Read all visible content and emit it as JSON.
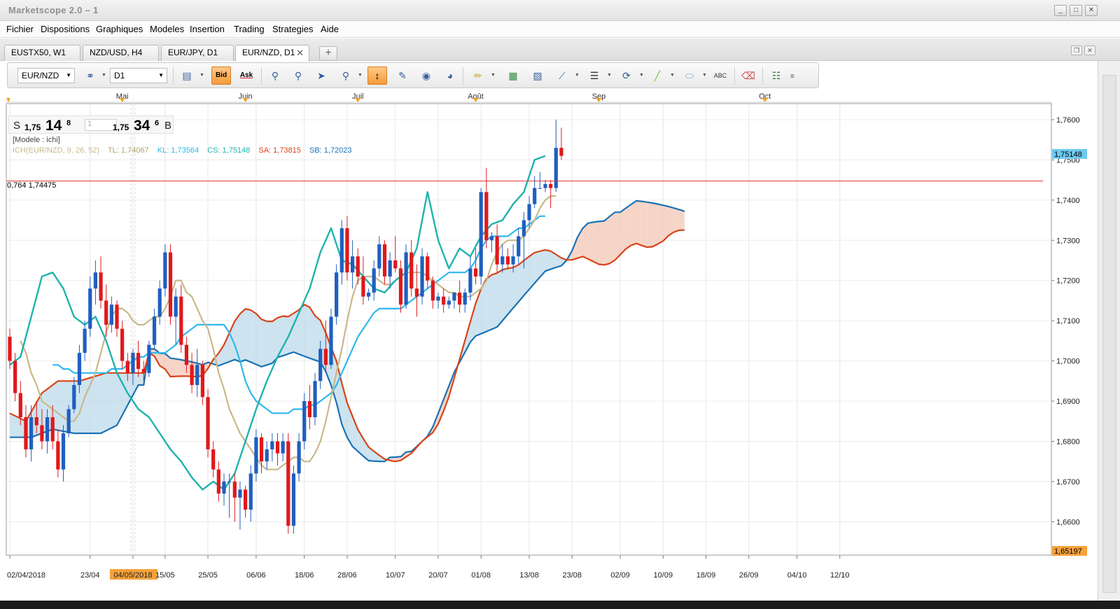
{
  "window": {
    "title": "Marketscope 2.0 – 1"
  },
  "menu": [
    "Fichier",
    "Dispositions",
    "Graphiques",
    "Modeles",
    "Insertion",
    "Trading",
    "Strategies",
    "Aide"
  ],
  "tabs": [
    {
      "label": "EUSTX50, W1",
      "active": false
    },
    {
      "label": "NZD/USD, H4",
      "active": false
    },
    {
      "label": "EUR/JPY, D1",
      "active": false
    },
    {
      "label": "EUR/NZD, D1",
      "active": true
    }
  ],
  "toolbar": {
    "instrument": "EUR/NZD",
    "timeframe": "D1",
    "bid_label": "Bid",
    "ask_label": "Ask"
  },
  "quote": {
    "sell_label": "S",
    "buy_label": "B",
    "sell_price_prefix": "1,75",
    "sell_price_big": "14",
    "sell_price_pip": "8",
    "quantity": "1",
    "buy_price_prefix": "1,75",
    "buy_price_big": "34",
    "buy_price_pip": "6"
  },
  "legend": {
    "model": "[Modele : ichi]",
    "indicator": "ICH(EUR/NZD, 9, 26, 52)",
    "tl": "TL: 1,74067",
    "kl": "KL: 1,73564",
    "cs": "CS: 1,75148",
    "sa": "SA: 1,73815",
    "sb": "SB: 1,72023"
  },
  "fib_line": {
    "label": "0,764 1,74475",
    "price": 1.74475
  },
  "colors": {
    "bull": "#1f5fbf",
    "bear": "#e0181c",
    "tenkan": "#c8b88a",
    "kijun": "#2fb8ee",
    "chikou": "#1fb3ad",
    "spanA": "#d8441a",
    "spanB": "#1a72b4",
    "kumo_bull": "#bcd9ea",
    "kumo_bear": "#f3c7b6",
    "fib": "#e03030"
  },
  "chart_data": {
    "type": "candlestick",
    "instrument": "EUR/NZD",
    "timeframe": "D1",
    "ylim": [
      1.6517,
      1.764
    ],
    "y_ticks": [
      "1,7600",
      "1,7500",
      "1,7400",
      "1,7300",
      "1,7200",
      "1,7100",
      "1,7000",
      "1,6900",
      "1,6800",
      "1,6700",
      "1,6600"
    ],
    "y_values": [
      1.76,
      1.75,
      1.74,
      1.73,
      1.72,
      1.71,
      1.7,
      1.69,
      1.68,
      1.67,
      1.66
    ],
    "last_price_label": "1,75148",
    "last_price": 1.75148,
    "low_price_label": "1,65197",
    "low_price": 1.65197,
    "x_labels": [
      "02/04/2018",
      "23/04",
      "04/05/2018",
      "15/05",
      "25/05",
      "06/06",
      "18/06",
      "28/06",
      "10/07",
      "20/07",
      "01/08",
      "13/08",
      "23/08",
      "02/09",
      "10/09",
      "18/09",
      "26/09",
      "04/10",
      "12/10"
    ],
    "x_label_index": [
      0,
      15,
      23,
      29,
      37,
      46,
      55,
      63,
      72,
      80,
      88,
      97,
      105,
      114,
      122,
      130,
      138,
      147,
      155
    ],
    "highlight_label": "04/05/2018",
    "month_labels": [
      "Mai",
      "Juin",
      "Juil",
      "Août",
      "Sep",
      "Oct"
    ],
    "month_index": [
      21,
      44,
      65,
      87,
      110,
      141
    ],
    "candles_ohlc": [
      [
        1.706,
        1.708,
        1.698,
        1.7
      ],
      [
        1.7,
        1.702,
        1.69,
        1.692
      ],
      [
        1.692,
        1.695,
        1.684,
        1.686
      ],
      [
        1.686,
        1.689,
        1.676,
        1.678
      ],
      [
        1.678,
        1.689,
        1.675,
        1.686
      ],
      [
        1.686,
        1.69,
        1.682,
        1.684
      ],
      [
        1.684,
        1.688,
        1.678,
        1.68
      ],
      [
        1.68,
        1.688,
        1.677,
        1.686
      ],
      [
        1.686,
        1.689,
        1.678,
        1.68
      ],
      [
        1.68,
        1.683,
        1.671,
        1.673
      ],
      [
        1.673,
        1.684,
        1.67,
        1.682
      ],
      [
        1.682,
        1.689,
        1.681,
        1.688
      ],
      [
        1.688,
        1.696,
        1.687,
        1.694
      ],
      [
        1.694,
        1.704,
        1.692,
        1.702
      ],
      [
        1.702,
        1.71,
        1.7,
        1.708
      ],
      [
        1.708,
        1.721,
        1.706,
        1.718
      ],
      [
        1.718,
        1.725,
        1.714,
        1.722
      ],
      [
        1.722,
        1.726,
        1.713,
        1.715
      ],
      [
        1.715,
        1.719,
        1.706,
        1.709
      ],
      [
        1.709,
        1.716,
        1.707,
        1.714
      ],
      [
        1.714,
        1.715,
        1.706,
        1.708
      ],
      [
        1.708,
        1.71,
        1.698,
        1.7
      ],
      [
        1.7,
        1.702,
        1.695,
        1.697
      ],
      [
        1.697,
        1.703,
        1.694,
        1.702
      ],
      [
        1.702,
        1.705,
        1.696,
        1.698
      ],
      [
        1.698,
        1.7,
        1.695,
        1.697
      ],
      [
        1.697,
        1.705,
        1.696,
        1.704
      ],
      [
        1.704,
        1.713,
        1.703,
        1.711
      ],
      [
        1.711,
        1.72,
        1.709,
        1.718
      ],
      [
        1.718,
        1.729,
        1.716,
        1.727
      ],
      [
        1.727,
        1.729,
        1.709,
        1.711
      ],
      [
        1.711,
        1.718,
        1.704,
        1.716
      ],
      [
        1.716,
        1.719,
        1.702,
        1.704
      ],
      [
        1.704,
        1.706,
        1.697,
        1.699
      ],
      [
        1.699,
        1.702,
        1.692,
        1.694
      ],
      [
        1.694,
        1.703,
        1.691,
        1.699
      ],
      [
        1.699,
        1.7,
        1.689,
        1.691
      ],
      [
        1.691,
        1.693,
        1.676,
        1.678
      ],
      [
        1.678,
        1.68,
        1.671,
        1.673
      ],
      [
        1.673,
        1.675,
        1.665,
        1.667
      ],
      [
        1.667,
        1.672,
        1.664,
        1.67
      ],
      [
        1.67,
        1.672,
        1.661,
        1.67
      ],
      [
        1.67,
        1.672,
        1.66,
        1.666
      ],
      [
        1.666,
        1.67,
        1.658,
        1.668
      ],
      [
        1.668,
        1.669,
        1.661,
        1.663
      ],
      [
        1.663,
        1.674,
        1.66,
        1.672
      ],
      [
        1.672,
        1.683,
        1.67,
        1.681
      ],
      [
        1.681,
        1.682,
        1.672,
        1.675
      ],
      [
        1.675,
        1.68,
        1.673,
        1.678
      ],
      [
        1.678,
        1.682,
        1.675,
        1.68
      ],
      [
        1.68,
        1.682,
        1.674,
        1.677
      ],
      [
        1.677,
        1.682,
        1.675,
        1.68
      ],
      [
        1.68,
        1.682,
        1.657,
        1.659
      ],
      [
        1.659,
        1.674,
        1.657,
        1.672
      ],
      [
        1.672,
        1.682,
        1.67,
        1.68
      ],
      [
        1.68,
        1.692,
        1.678,
        1.69
      ],
      [
        1.69,
        1.694,
        1.683,
        1.686
      ],
      [
        1.686,
        1.697,
        1.684,
        1.695
      ],
      [
        1.695,
        1.705,
        1.693,
        1.703
      ],
      [
        1.703,
        1.71,
        1.697,
        1.699
      ],
      [
        1.699,
        1.713,
        1.698,
        1.711
      ],
      [
        1.711,
        1.724,
        1.709,
        1.722
      ],
      [
        1.722,
        1.735,
        1.719,
        1.733
      ],
      [
        1.733,
        1.736,
        1.72,
        1.722
      ],
      [
        1.722,
        1.73,
        1.718,
        1.726
      ],
      [
        1.726,
        1.728,
        1.719,
        1.721
      ],
      [
        1.721,
        1.726,
        1.714,
        1.716
      ],
      [
        1.716,
        1.718,
        1.715,
        1.717
      ],
      [
        1.717,
        1.725,
        1.715,
        1.723
      ],
      [
        1.723,
        1.731,
        1.721,
        1.729
      ],
      [
        1.729,
        1.73,
        1.719,
        1.721
      ],
      [
        1.721,
        1.727,
        1.718,
        1.725
      ],
      [
        1.725,
        1.731,
        1.722,
        1.723
      ],
      [
        1.723,
        1.725,
        1.712,
        1.714
      ],
      [
        1.714,
        1.729,
        1.713,
        1.727
      ],
      [
        1.727,
        1.73,
        1.716,
        1.718
      ],
      [
        1.718,
        1.724,
        1.711,
        1.716
      ],
      [
        1.716,
        1.728,
        1.714,
        1.726
      ],
      [
        1.726,
        1.727,
        1.718,
        1.72
      ],
      [
        1.72,
        1.721,
        1.713,
        1.715
      ],
      [
        1.715,
        1.717,
        1.713,
        1.716
      ],
      [
        1.716,
        1.718,
        1.712,
        1.714
      ],
      [
        1.714,
        1.716,
        1.713,
        1.715
      ],
      [
        1.715,
        1.717,
        1.713,
        1.717
      ],
      [
        1.717,
        1.72,
        1.712,
        1.714
      ],
      [
        1.714,
        1.718,
        1.712,
        1.717
      ],
      [
        1.717,
        1.726,
        1.715,
        1.723
      ],
      [
        1.723,
        1.728,
        1.719,
        1.721
      ],
      [
        1.721,
        1.743,
        1.719,
        1.742
      ],
      [
        1.742,
        1.748,
        1.728,
        1.73
      ],
      [
        1.73,
        1.732,
        1.727,
        1.731
      ],
      [
        1.731,
        1.734,
        1.722,
        1.724
      ],
      [
        1.724,
        1.729,
        1.722,
        1.726
      ],
      [
        1.726,
        1.728,
        1.723,
        1.724
      ],
      [
        1.724,
        1.729,
        1.722,
        1.726
      ],
      [
        1.726,
        1.733,
        1.724,
        1.731
      ],
      [
        1.731,
        1.737,
        1.723,
        1.735
      ],
      [
        1.735,
        1.741,
        1.733,
        1.739
      ],
      [
        1.739,
        1.746,
        1.738,
        1.743
      ],
      [
        1.743,
        1.747,
        1.743,
        1.743
      ],
      [
        1.743,
        1.745,
        1.742,
        1.744
      ],
      [
        1.744,
        1.745,
        1.738,
        1.743
      ],
      [
        1.743,
        1.76,
        1.742,
        1.753
      ],
      [
        1.753,
        1.758,
        1.75,
        1.751
      ]
    ],
    "tenkan_sen": [
      1.705,
      1.702,
      1.697,
      1.694,
      1.69,
      1.689,
      1.688,
      1.687,
      1.686,
      1.685,
      1.685,
      1.687,
      1.691,
      1.694,
      1.697,
      1.702,
      1.707,
      1.711,
      1.713,
      1.713,
      1.712,
      1.71,
      1.709,
      1.709,
      1.71,
      1.711,
      1.711,
      1.713,
      1.716,
      1.72,
      1.72,
      1.717,
      1.716,
      1.713,
      1.71,
      1.708,
      1.703,
      1.697,
      1.693,
      1.688,
      1.685,
      1.682,
      1.68,
      1.678,
      1.676,
      1.674,
      1.673,
      1.673,
      1.673,
      1.674,
      1.675,
      1.676,
      1.676,
      1.675,
      1.675,
      1.677,
      1.68,
      1.685,
      1.691,
      1.697,
      1.703,
      1.71,
      1.716,
      1.72,
      1.721,
      1.721,
      1.721,
      1.72,
      1.719,
      1.719,
      1.72,
      1.721,
      1.722,
      1.722,
      1.722,
      1.722,
      1.721,
      1.72,
      1.719,
      1.718,
      1.717,
      1.717,
      1.716,
      1.716,
      1.716,
      1.717,
      1.718,
      1.72,
      1.724,
      1.727,
      1.729,
      1.73,
      1.73,
      1.73,
      1.731,
      1.733,
      1.735,
      1.738,
      1.74,
      1.741,
      1.741
    ],
    "kijun_sen": [
      1.699,
      1.699,
      1.698,
      1.698,
      1.697,
      1.697,
      1.697,
      1.697,
      1.697,
      1.697,
      1.697,
      1.698,
      1.698,
      1.698,
      1.699,
      1.7,
      1.701,
      1.701,
      1.702,
      1.702,
      1.702,
      1.702,
      1.703,
      1.704,
      1.706,
      1.707,
      1.708,
      1.709,
      1.709,
      1.709,
      1.709,
      1.709,
      1.709,
      1.707,
      1.704,
      1.7,
      1.695,
      1.692,
      1.69,
      1.689,
      1.688,
      1.687,
      1.687,
      1.687,
      1.687,
      1.688,
      1.688,
      1.688,
      1.689,
      1.689,
      1.69,
      1.691,
      1.692,
      1.694,
      1.697,
      1.7,
      1.703,
      1.706,
      1.708,
      1.71,
      1.712,
      1.713,
      1.713,
      1.713,
      1.713,
      1.713,
      1.714,
      1.715,
      1.716,
      1.717,
      1.718,
      1.719,
      1.72,
      1.721,
      1.722,
      1.722,
      1.722,
      1.722,
      1.723,
      1.725,
      1.728,
      1.73,
      1.731,
      1.731,
      1.731,
      1.731,
      1.732,
      1.733,
      1.733,
      1.734,
      1.735,
      1.736,
      1.736
    ],
    "chikou_span": [
      1.699,
      1.701,
      1.711,
      1.721,
      1.722,
      1.718,
      1.711,
      1.709,
      1.711,
      1.705,
      1.697,
      1.692,
      1.688,
      1.686,
      1.682,
      1.678,
      1.675,
      1.671,
      1.668,
      1.67,
      1.668,
      1.672,
      1.68,
      1.688,
      1.695,
      1.701,
      1.706,
      1.712,
      1.718,
      1.727,
      1.733,
      1.725,
      1.724,
      1.721,
      1.718,
      1.717,
      1.72,
      1.722,
      1.728,
      1.742,
      1.73,
      1.723,
      1.728,
      1.726,
      1.731,
      1.734,
      1.735,
      1.739,
      1.742,
      1.75,
      1.751
    ]
  }
}
